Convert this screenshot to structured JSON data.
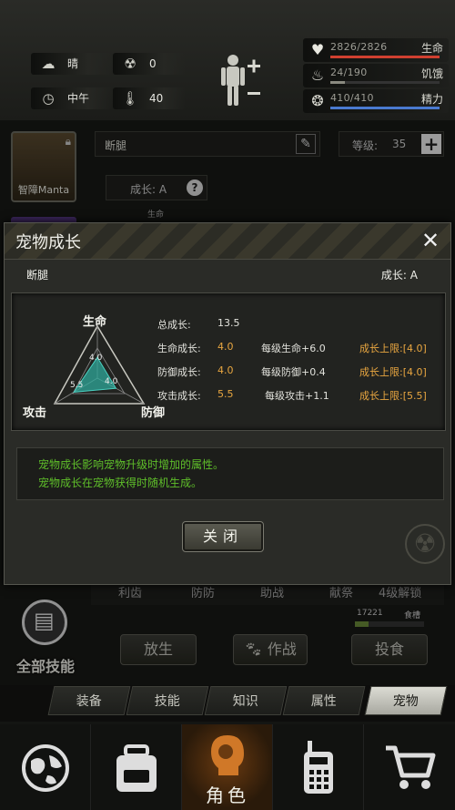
{
  "status": {
    "weather": "晴",
    "radiation": "0",
    "time": "中午",
    "temperature": "40"
  },
  "stats": [
    {
      "value": "2826/2826",
      "label": "生命",
      "fill": 1.0,
      "color": "#d04030"
    },
    {
      "value": "24/190",
      "label": "饥饿",
      "fill": 0.13,
      "color": "#8a8a80"
    },
    {
      "value": "410/410",
      "label": "精力",
      "fill": 1.0,
      "color": "#4a7ad0"
    }
  ],
  "pet": {
    "name_badge": "智障Manta",
    "name_field": "断腿",
    "level_label": "等级:",
    "level_value": "35",
    "growth_bg": "成长: A",
    "life_bg": "生命"
  },
  "bg_columns": [
    "利齿",
    "防防",
    "助战",
    "献祭",
    "4级解锁"
  ],
  "food": {
    "count": "17221",
    "label": "食槽"
  },
  "all_skills": "全部技能",
  "action_buttons": [
    "放生",
    "作战",
    "投食"
  ],
  "modal": {
    "title": "宠物成长",
    "pet_name": "断腿",
    "growth_grade": "成长: A",
    "radar": {
      "label_life": "生命",
      "label_attack": "攻击",
      "label_defense": "防御",
      "life": "4.0",
      "attack": "5.5",
      "defense": "4.0",
      "values": {
        "life": 4.0,
        "attack": 5.5,
        "defense": 4.0
      }
    },
    "total_label": "总成长:",
    "total_value": "13.5",
    "rows": [
      {
        "label": "生命成长:",
        "value": "4.0",
        "per": "每级生命+6.0",
        "cap": "成长上限:[4.0]"
      },
      {
        "label": "防御成长:",
        "value": "4.0",
        "per": "每级防御+0.4",
        "cap": "成长上限:[4.0]"
      },
      {
        "label": "攻击成长:",
        "value": "5.5",
        "per": "每级攻击+1.1",
        "cap": "成长上限:[5.5]"
      }
    ],
    "notes": [
      "宠物成长影响宠物升级时增加的属性。",
      "宠物成长在宠物获得时随机生成。"
    ],
    "close_label": "关闭"
  },
  "tabs": [
    "装备",
    "技能",
    "知识",
    "属性",
    "宠物"
  ],
  "active_tab": "宠物",
  "nav": [
    {
      "icon": "globe-icon",
      "label": ""
    },
    {
      "icon": "backpack-icon",
      "label": ""
    },
    {
      "icon": "character-head-icon",
      "label": "角色"
    },
    {
      "icon": "walkie-talkie-icon",
      "label": ""
    },
    {
      "icon": "shopping-cart-icon",
      "label": ""
    }
  ]
}
